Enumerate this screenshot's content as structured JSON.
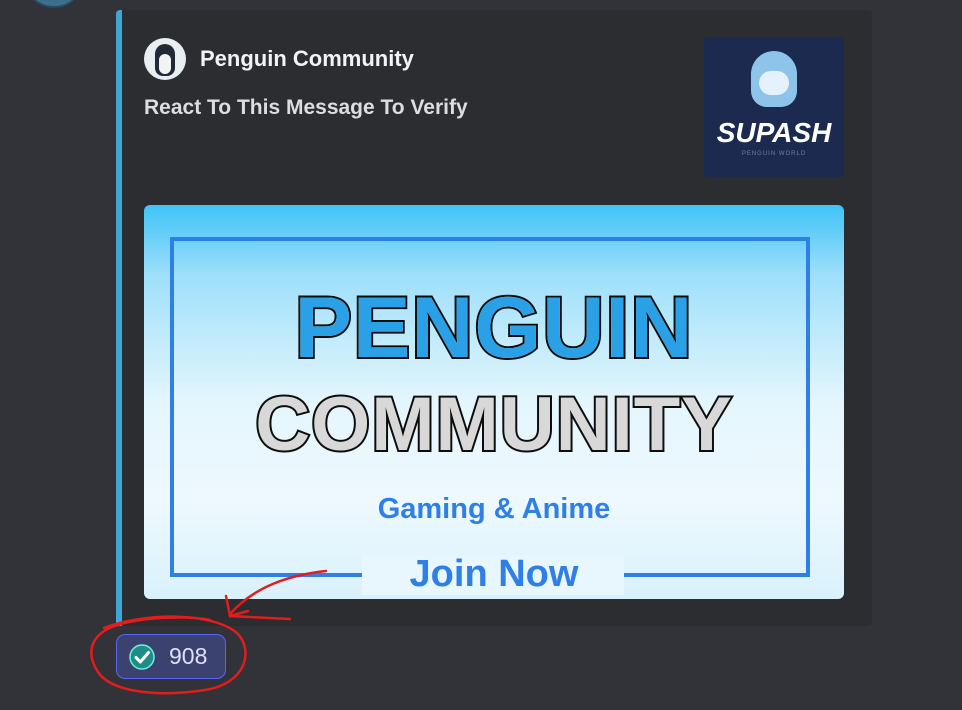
{
  "embed": {
    "author_name": "Penguin Community",
    "title": "React To This Message To Verify",
    "accent_color": "#3fa7d6",
    "thumbnail": {
      "text": "SUPASH",
      "subtext": "PENGUIN WORLD"
    },
    "banner": {
      "line1": "PENGUIN",
      "line2": "COMMUNITY",
      "line3": "Gaming & Anime",
      "line4": "Join Now"
    }
  },
  "reaction": {
    "icon": "check-circle-icon",
    "count": "908",
    "highlight_color": "#5865f2"
  },
  "annotation": {
    "color": "#e11d1d",
    "shapes": [
      "circle",
      "arrow"
    ]
  }
}
